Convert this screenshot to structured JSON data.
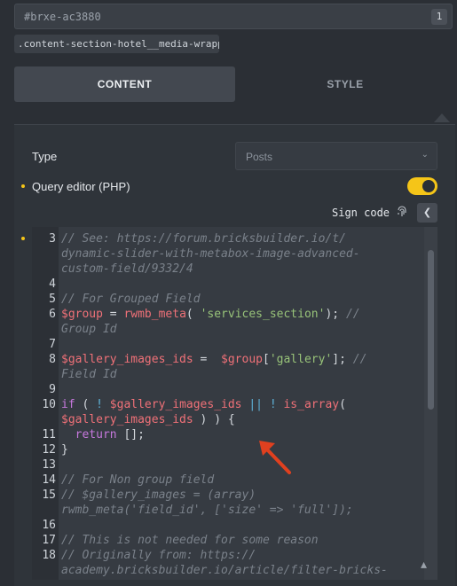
{
  "element_id": "#brxe-ac3880",
  "element_badge": "1",
  "css_class": ".content-section-hotel__media-wrapper",
  "tabs": {
    "content": "CONTENT",
    "style": "STYLE"
  },
  "type_field": {
    "label": "Type",
    "value": "Posts"
  },
  "query_editor": {
    "label": "Query editor (PHP)",
    "enabled": true
  },
  "sign_code": "Sign code",
  "colors": {
    "accent": "#f5c518",
    "comment": "#7a818a",
    "keyword": "#c678dd",
    "variable": "#f07178",
    "string": "#98c379",
    "operator": "#5fb3d9"
  },
  "code": {
    "lines": [
      {
        "n": "3",
        "segs": [
          {
            "t": "cmt",
            "v": "// See: https://forum.bricksbuilder.io/t/"
          }
        ]
      },
      {
        "n": "",
        "segs": [
          {
            "t": "cmt",
            "v": "dynamic-slider-with-metabox-image-advanced-"
          }
        ]
      },
      {
        "n": "",
        "segs": [
          {
            "t": "cmt",
            "v": "custom-field/9332/4"
          }
        ]
      },
      {
        "n": "4",
        "segs": []
      },
      {
        "n": "5",
        "segs": [
          {
            "t": "cmt",
            "v": "// For Grouped Field"
          }
        ]
      },
      {
        "n": "6",
        "segs": [
          {
            "t": "var",
            "v": "$group"
          },
          {
            "t": "pun",
            "v": " = "
          },
          {
            "t": "fn",
            "v": "rwmb_meta"
          },
          {
            "t": "pun",
            "v": "( "
          },
          {
            "t": "str",
            "v": "'services_section'"
          },
          {
            "t": "pun",
            "v": "); "
          },
          {
            "t": "cmt",
            "v": "//"
          }
        ]
      },
      {
        "n": "",
        "segs": [
          {
            "t": "cmt",
            "v": "Group Id"
          }
        ]
      },
      {
        "n": "7",
        "segs": []
      },
      {
        "n": "8",
        "segs": [
          {
            "t": "var",
            "v": "$gallery_images_ids"
          },
          {
            "t": "pun",
            "v": " =  "
          },
          {
            "t": "var",
            "v": "$group"
          },
          {
            "t": "pun",
            "v": "["
          },
          {
            "t": "str",
            "v": "'gallery'"
          },
          {
            "t": "pun",
            "v": "]; "
          },
          {
            "t": "cmt",
            "v": "//"
          }
        ]
      },
      {
        "n": "",
        "segs": [
          {
            "t": "cmt",
            "v": "Field Id"
          }
        ]
      },
      {
        "n": "9",
        "segs": []
      },
      {
        "n": "10",
        "segs": [
          {
            "t": "kw",
            "v": "if"
          },
          {
            "t": "pun",
            "v": " ( "
          },
          {
            "t": "op",
            "v": "!"
          },
          {
            "t": "pun",
            "v": " "
          },
          {
            "t": "var",
            "v": "$gallery_images_ids"
          },
          {
            "t": "pun",
            "v": " "
          },
          {
            "t": "op",
            "v": "||"
          },
          {
            "t": "pun",
            "v": " "
          },
          {
            "t": "op",
            "v": "!"
          },
          {
            "t": "pun",
            "v": " "
          },
          {
            "t": "fn",
            "v": "is_array"
          },
          {
            "t": "pun",
            "v": "("
          }
        ]
      },
      {
        "n": "",
        "segs": [
          {
            "t": "var",
            "v": "$gallery_images_ids"
          },
          {
            "t": "pun",
            "v": " ) ) {"
          }
        ]
      },
      {
        "n": "11",
        "segs": [
          {
            "t": "pun",
            "v": "  "
          },
          {
            "t": "kw",
            "v": "return"
          },
          {
            "t": "pun",
            "v": " [];"
          }
        ]
      },
      {
        "n": "12",
        "segs": [
          {
            "t": "pun",
            "v": "}"
          }
        ]
      },
      {
        "n": "13",
        "segs": []
      },
      {
        "n": "14",
        "segs": [
          {
            "t": "cmt",
            "v": "// For Non group field"
          }
        ]
      },
      {
        "n": "15",
        "segs": [
          {
            "t": "cmt",
            "v": "// $gallery_images = (array)"
          }
        ]
      },
      {
        "n": "",
        "segs": [
          {
            "t": "cmt",
            "v": "rwmb_meta('field_id', ['size' => 'full']);"
          }
        ]
      },
      {
        "n": "16",
        "segs": []
      },
      {
        "n": "17",
        "segs": [
          {
            "t": "cmt",
            "v": "// This is not needed for some reason"
          }
        ]
      },
      {
        "n": "18",
        "segs": [
          {
            "t": "cmt",
            "v": "// Originally from: https://"
          }
        ]
      },
      {
        "n": "",
        "segs": [
          {
            "t": "cmt",
            "v": "academy.bricksbuilder.io/article/filter-bricks-"
          }
        ]
      }
    ]
  }
}
